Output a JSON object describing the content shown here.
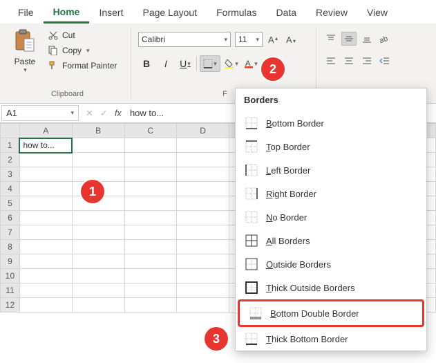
{
  "menu": {
    "items": [
      "File",
      "Home",
      "Insert",
      "Page Layout",
      "Formulas",
      "Data",
      "Review",
      "View"
    ],
    "active": 1
  },
  "ribbon": {
    "clipboard": {
      "label": "Clipboard",
      "paste": "Paste",
      "cut": "Cut",
      "copy": "Copy",
      "formatpainter": "Format Painter"
    },
    "font": {
      "label": "Font",
      "name": "Calibri",
      "size": "11"
    }
  },
  "namebox": "A1",
  "formula": "how to...",
  "cellA1": "how to...",
  "cols": [
    "A",
    "B",
    "C",
    "D"
  ],
  "rows": [
    "1",
    "2",
    "3",
    "4",
    "5",
    "6",
    "7",
    "8",
    "9",
    "10",
    "11",
    "12"
  ],
  "borders": {
    "title": "Borders",
    "items": [
      {
        "label": "Bottom Border",
        "accel": "B"
      },
      {
        "label": "Top Border",
        "accel": "T"
      },
      {
        "label": "Left Border",
        "accel": "L"
      },
      {
        "label": "Right Border",
        "accel": "R"
      },
      {
        "label": "No Border",
        "accel": "N"
      },
      {
        "label": "All Borders",
        "accel": "A"
      },
      {
        "label": "Outside Borders",
        "accel": "O"
      },
      {
        "label": "Thick Outside Borders",
        "accel": "T"
      },
      {
        "label": "Bottom Double Border",
        "accel": "B",
        "highlight": true
      },
      {
        "label": "Thick Bottom Border",
        "accel": "T"
      }
    ]
  },
  "steps": {
    "1": "1",
    "2": "2",
    "3": "3"
  }
}
